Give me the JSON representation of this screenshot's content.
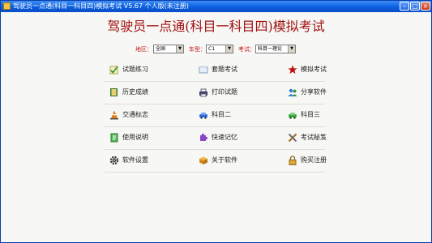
{
  "window": {
    "title": "驾驶员一点通(科目一科目四)模拟考试 V5.67 个人版(未注册)",
    "controls": {
      "minimize": "–",
      "maximize": "□",
      "close": "×"
    }
  },
  "app_title": "驾驶员一点通(科目一科目四)模拟考试",
  "filters": {
    "region_label": "地区：",
    "region_value": "全国",
    "cartype_label": "车型：",
    "cartype_value": "C1",
    "exam_label": "考试：",
    "exam_value": "科目一理论"
  },
  "menu": {
    "rows": [
      [
        {
          "label": "试题练习",
          "icon": "pencil-check-icon"
        },
        {
          "label": "套题考试",
          "icon": "paper-stack-icon"
        },
        {
          "label": "模拟考试",
          "icon": "star-icon"
        }
      ],
      [
        {
          "label": "历史成绩",
          "icon": "book-icon"
        },
        {
          "label": "打印试题",
          "icon": "printer-icon"
        },
        {
          "label": "分享软件",
          "icon": "users-icon"
        }
      ],
      [
        {
          "label": "交通标志",
          "icon": "traffic-cone-icon"
        },
        {
          "label": "科目二",
          "icon": "blue-car-icon"
        },
        {
          "label": "科目三",
          "icon": "green-car-icon"
        }
      ],
      [
        {
          "label": "使用说明",
          "icon": "document-icon"
        },
        {
          "label": "快速记忆",
          "icon": "puzzle-icon"
        },
        {
          "label": "考试秘笈",
          "icon": "tools-icon"
        }
      ],
      [
        {
          "label": "软件设置",
          "icon": "gear-icon"
        },
        {
          "label": "关于软件",
          "icon": "box-icon"
        },
        {
          "label": "购买注册",
          "icon": "lock-icon"
        }
      ]
    ]
  },
  "colors": {
    "titlebar": "#0a5fe0",
    "app_title": "#a01010",
    "filter_label": "#c01818"
  }
}
